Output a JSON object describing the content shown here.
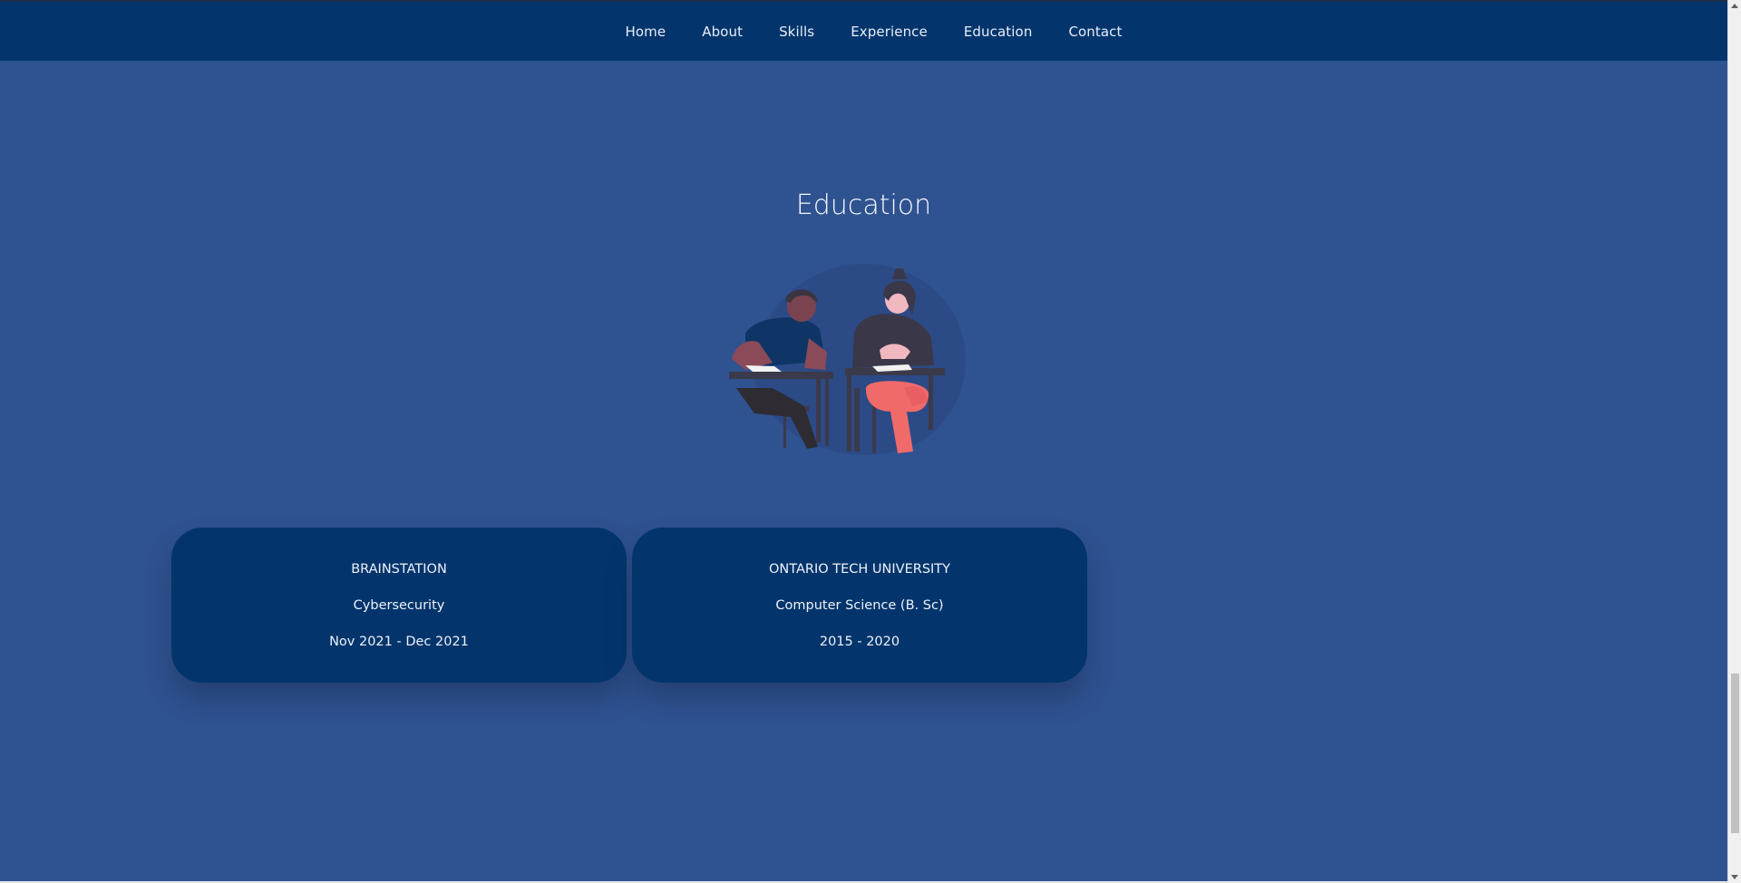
{
  "nav": {
    "items": [
      {
        "label": "Home"
      },
      {
        "label": "About"
      },
      {
        "label": "Skills"
      },
      {
        "label": "Experience"
      },
      {
        "label": "Education"
      },
      {
        "label": "Contact"
      }
    ]
  },
  "section": {
    "title": "Education"
  },
  "education": [
    {
      "institution": "BRAINSTATION",
      "program": "Cybersecurity",
      "dates": "Nov 2021 - Dec 2021"
    },
    {
      "institution": "ONTARIO TECH UNIVERSITY",
      "program": "Computer Science (B. Sc)",
      "dates": "2015 - 2020"
    }
  ],
  "illustration": {
    "icon": "students-studying-illustration"
  },
  "colors": {
    "page_bg": "#2f5290",
    "navbar_bg": "#03356c",
    "card_bg": "#03356c"
  }
}
